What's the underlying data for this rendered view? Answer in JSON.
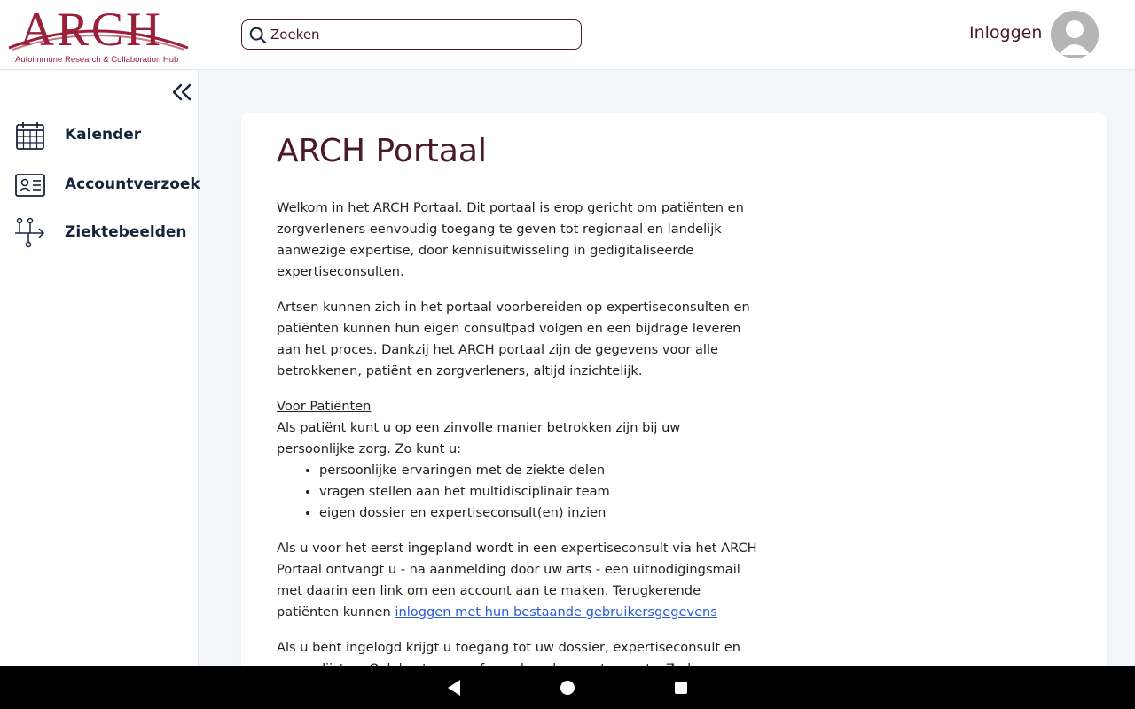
{
  "header": {
    "logo_text": "ARCH",
    "logo_tagline": "Autoimmune Research & Collaboration Hub",
    "search_placeholder": "Zoeken",
    "login_label": "Inloggen"
  },
  "sidebar": {
    "items": [
      {
        "label": "Kalender",
        "icon": "calendar-icon"
      },
      {
        "label": "Accountverzoek",
        "icon": "id-card-icon"
      },
      {
        "label": "Ziektebeelden",
        "icon": "flow-icon"
      }
    ]
  },
  "main": {
    "title": "ARCH Portaal",
    "p1": "Welkom in het ARCH Portaal. Dit portaal is erop gericht om patiënten en zorgverleners eenvoudig toegang te geven tot regionaal en landelijk aanwezige expertise, door kennisuitwisseling in gedigitaliseerde expertiseconsulten.",
    "p2": "Artsen kunnen zich in het portaal voorbereiden op expertiseconsulten en patiënten kunnen hun eigen consultpad volgen en een bijdrage leveren aan het proces. Dankzij het ARCH portaal zijn de gegevens voor alle betrokkenen, patiënt en zorgverleners, altijd inzichtelijk.",
    "section_heading": "Voor Patiënten",
    "p3": "Als patiënt kunt u op een zinvolle manier betrokken zijn bij uw persoonlijke zorg. Zo kunt u:",
    "bullets": [
      "persoonlijke ervaringen met de ziekte delen",
      "vragen stellen aan het multidisciplinair team",
      "eigen dossier en expertiseconsult(en) inzien"
    ],
    "p4_text": "Als u voor het eerst ingepland wordt in een expertiseconsult via het ARCH Portaal ontvangt u - na aanmelding door uw arts - een uitnodigingsmail met daarin een link om een account aan te maken. Terugkerende patiënten kunnen ",
    "p4_link": "inloggen met hun bestaande gebruikersgegevens",
    "p5": "Als u bent ingelogd krijgt u toegang tot uw dossier, expertiseconsult en vragenlijsten. Ook kunt u een afspraak maken met uw arts. Zodra uw dossier compleet is"
  },
  "colors": {
    "brand": "#9a1f3a",
    "text_dark": "#4a1a28",
    "link": "#2a5bd7"
  },
  "system_nav": {
    "back": "back-icon",
    "home": "home-icon",
    "recent": "recent-apps-icon"
  }
}
